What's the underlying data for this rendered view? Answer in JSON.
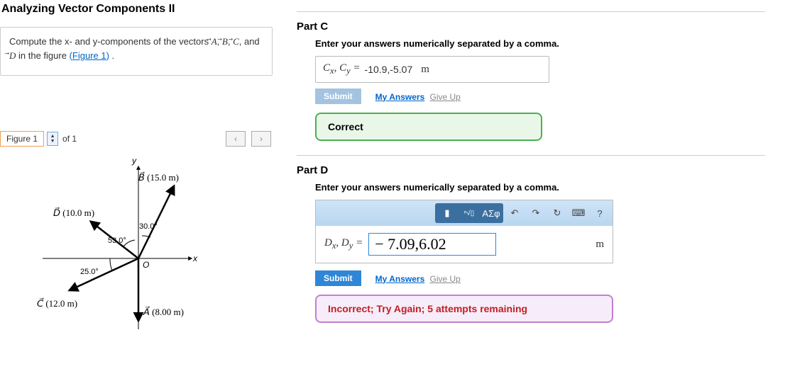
{
  "title": "Analyzing Vector Components II",
  "prompt": {
    "prefix": "Compute the x- and y-components of the vectors ",
    "suffix": " in the figure ",
    "figlink": "(Figure 1)",
    "end": " ."
  },
  "figure": {
    "label": "Figure 1",
    "of": "of 1",
    "vectors": {
      "B": {
        "label": "B",
        "mag": "(15.0 m)",
        "angle": "30.0°"
      },
      "D": {
        "label": "D",
        "mag": "(10.0 m)",
        "angle": "53.0°"
      },
      "C": {
        "label": "C",
        "mag": "(12.0 m)",
        "angle": "25.0°"
      },
      "A": {
        "label": "A",
        "mag": "(8.00 m)"
      }
    },
    "axes": {
      "x": "x",
      "y": "y",
      "o": "O"
    }
  },
  "partC": {
    "title": "Part C",
    "instruct": "Enter your answers numerically separated by a comma.",
    "var": "C",
    "value": "-10.9,-5.07",
    "unit": "m",
    "submit": "Submit",
    "myanswers": "My Answers",
    "giveup": "Give Up",
    "feedback": "Correct"
  },
  "partD": {
    "title": "Part D",
    "instruct": "Enter your answers numerically separated by a comma.",
    "var": "D",
    "value": "− 7.09,6.02",
    "unit": "m",
    "submit": "Submit",
    "myanswers": "My Answers",
    "giveup": "Give Up",
    "feedback": "Incorrect; Try Again; 5 attempts remaining",
    "symbols": "ΑΣφ"
  },
  "chart_data": {
    "type": "vector-diagram",
    "origin": "O",
    "axes": [
      "x",
      "y"
    ],
    "vectors": [
      {
        "name": "A",
        "magnitude": 8.0,
        "unit": "m",
        "angle_from_neg_y_axis_deg": 0,
        "quadrant": "down",
        "note": "along -y"
      },
      {
        "name": "B",
        "magnitude": 15.0,
        "unit": "m",
        "angle_from_pos_y_axis_deg": 30.0,
        "quadrant": "Q1"
      },
      {
        "name": "C",
        "magnitude": 12.0,
        "unit": "m",
        "angle_below_neg_x_axis_deg": 25.0,
        "quadrant": "Q3"
      },
      {
        "name": "D",
        "magnitude": 10.0,
        "unit": "m",
        "angle_from_pos_y_axis_deg_left": 53.0,
        "quadrant": "Q2"
      }
    ]
  }
}
